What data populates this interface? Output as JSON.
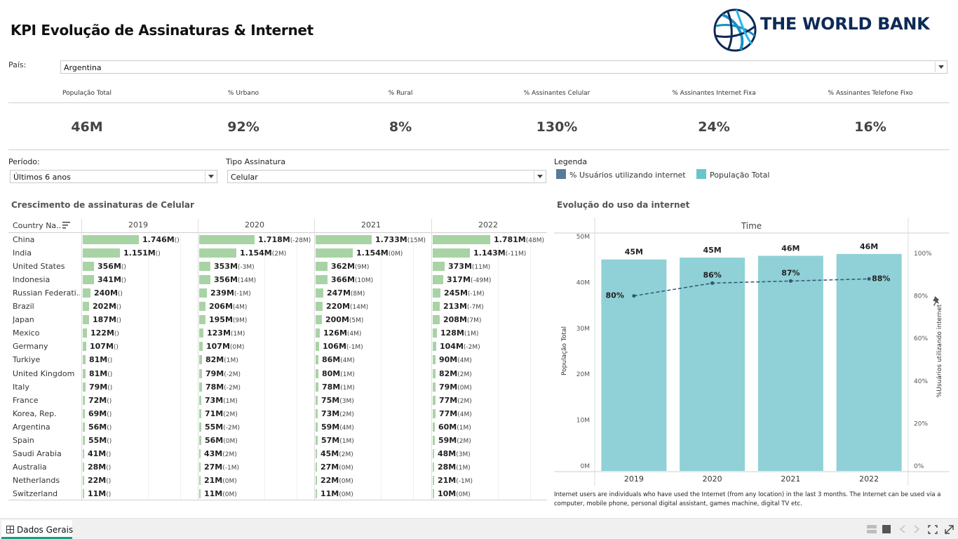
{
  "title": "KPI Evolução de Assinaturas & Internet",
  "logo": {
    "text": "THE WORLD BANK",
    "color": "#0d2a56"
  },
  "country_filter": {
    "label": "País:",
    "value": "Argentina"
  },
  "kpis": [
    {
      "label": "População Total",
      "value": "46M"
    },
    {
      "label": "% Urbano",
      "value": "92%"
    },
    {
      "label": "% Rural",
      "value": "8%"
    },
    {
      "label": "% Assinantes Celular",
      "value": "130%"
    },
    {
      "label": "% Assinantes Internet Fixa",
      "value": "24%"
    },
    {
      "label": "% Assinantes Telefone Fixo",
      "value": "16%"
    }
  ],
  "period_filter": {
    "label": "Período:",
    "value": "Últimos 6 anos"
  },
  "type_filter": {
    "label": "Tipo Assinatura",
    "value": "Celular"
  },
  "legend": {
    "title": "Legenda",
    "items": [
      {
        "label": "% Usuários utilizando internet",
        "color": "#5b7a99"
      },
      {
        "label": "População Total",
        "color": "#69c5c9"
      }
    ]
  },
  "table": {
    "title": "Crescimento de assinaturas de Celular",
    "column_header": "Country Na..",
    "years": [
      "2019",
      "2020",
      "2021",
      "2022"
    ],
    "rows": [
      {
        "country": "China",
        "cells": [
          [
            "1.746M",
            "()"
          ],
          [
            "1.718M",
            "(-28M)"
          ],
          [
            "1.733M",
            "(15M)"
          ],
          [
            "1.781M",
            "(48M)"
          ]
        ]
      },
      {
        "country": "India",
        "cells": [
          [
            "1.151M",
            "()"
          ],
          [
            "1.154M",
            "(2M)"
          ],
          [
            "1.154M",
            "(0M)"
          ],
          [
            "1.143M",
            "(-11M)"
          ]
        ]
      },
      {
        "country": "United States",
        "cells": [
          [
            "356M",
            "()"
          ],
          [
            "353M",
            "(-3M)"
          ],
          [
            "362M",
            "(9M)"
          ],
          [
            "373M",
            "(11M)"
          ]
        ]
      },
      {
        "country": "Indonesia",
        "cells": [
          [
            "341M",
            "()"
          ],
          [
            "356M",
            "(14M)"
          ],
          [
            "366M",
            "(10M)"
          ],
          [
            "317M",
            "(-49M)"
          ]
        ]
      },
      {
        "country": "Russian Federati..",
        "cells": [
          [
            "240M",
            "()"
          ],
          [
            "239M",
            "(-1M)"
          ],
          [
            "247M",
            "(8M)"
          ],
          [
            "245M",
            "(-1M)"
          ]
        ]
      },
      {
        "country": "Brazil",
        "cells": [
          [
            "202M",
            "()"
          ],
          [
            "206M",
            "(4M)"
          ],
          [
            "220M",
            "(14M)"
          ],
          [
            "213M",
            "(-7M)"
          ]
        ]
      },
      {
        "country": "Japan",
        "cells": [
          [
            "187M",
            "()"
          ],
          [
            "195M",
            "(9M)"
          ],
          [
            "200M",
            "(5M)"
          ],
          [
            "208M",
            "(7M)"
          ]
        ]
      },
      {
        "country": "Mexico",
        "cells": [
          [
            "122M",
            "()"
          ],
          [
            "123M",
            "(1M)"
          ],
          [
            "126M",
            "(4M)"
          ],
          [
            "128M",
            "(1M)"
          ]
        ]
      },
      {
        "country": "Germany",
        "cells": [
          [
            "107M",
            "()"
          ],
          [
            "107M",
            "(0M)"
          ],
          [
            "106M",
            "(-1M)"
          ],
          [
            "104M",
            "(-2M)"
          ]
        ]
      },
      {
        "country": "Turkiye",
        "cells": [
          [
            "81M",
            "()"
          ],
          [
            "82M",
            "(1M)"
          ],
          [
            "86M",
            "(4M)"
          ],
          [
            "90M",
            "(4M)"
          ]
        ]
      },
      {
        "country": "United Kingdom",
        "cells": [
          [
            "81M",
            "()"
          ],
          [
            "79M",
            "(-2M)"
          ],
          [
            "80M",
            "(1M)"
          ],
          [
            "82M",
            "(2M)"
          ]
        ]
      },
      {
        "country": "Italy",
        "cells": [
          [
            "79M",
            "()"
          ],
          [
            "78M",
            "(-2M)"
          ],
          [
            "78M",
            "(1M)"
          ],
          [
            "79M",
            "(0M)"
          ]
        ]
      },
      {
        "country": "France",
        "cells": [
          [
            "72M",
            "()"
          ],
          [
            "73M",
            "(1M)"
          ],
          [
            "75M",
            "(3M)"
          ],
          [
            "77M",
            "(2M)"
          ]
        ]
      },
      {
        "country": "Korea, Rep.",
        "cells": [
          [
            "69M",
            "()"
          ],
          [
            "71M",
            "(2M)"
          ],
          [
            "73M",
            "(2M)"
          ],
          [
            "77M",
            "(4M)"
          ]
        ]
      },
      {
        "country": "Argentina",
        "cells": [
          [
            "56M",
            "()"
          ],
          [
            "55M",
            "(-2M)"
          ],
          [
            "59M",
            "(4M)"
          ],
          [
            "60M",
            "(1M)"
          ]
        ]
      },
      {
        "country": "Spain",
        "cells": [
          [
            "55M",
            "()"
          ],
          [
            "56M",
            "(0M)"
          ],
          [
            "57M",
            "(1M)"
          ],
          [
            "59M",
            "(2M)"
          ]
        ]
      },
      {
        "country": "Saudi Arabia",
        "cells": [
          [
            "41M",
            "()"
          ],
          [
            "43M",
            "(2M)"
          ],
          [
            "45M",
            "(2M)"
          ],
          [
            "48M",
            "(3M)"
          ]
        ]
      },
      {
        "country": "Australia",
        "cells": [
          [
            "28M",
            "()"
          ],
          [
            "27M",
            "(-1M)"
          ],
          [
            "27M",
            "(0M)"
          ],
          [
            "28M",
            "(1M)"
          ]
        ]
      },
      {
        "country": "Netherlands",
        "cells": [
          [
            "22M",
            "()"
          ],
          [
            "21M",
            "(0M)"
          ],
          [
            "22M",
            "(0M)"
          ],
          [
            "21M",
            "(-1M)"
          ]
        ]
      },
      {
        "country": "Switzerland",
        "cells": [
          [
            "11M",
            "()"
          ],
          [
            "11M",
            "(0M)"
          ],
          [
            "11M",
            "(0M)"
          ],
          [
            "10M",
            "(0M)"
          ]
        ]
      }
    ]
  },
  "chart_data": {
    "type": "bar",
    "title": "Evolução do uso da internet",
    "x_header": "Time",
    "categories": [
      "2019",
      "2020",
      "2021",
      "2022"
    ],
    "series": [
      {
        "name": "População Total",
        "values": [
          45,
          45.4,
          45.8,
          46.2
        ],
        "value_labels": [
          "45M",
          "45M",
          "46M",
          "46M"
        ],
        "color": "#8fd1d6",
        "axis": "left"
      },
      {
        "name": "% Usuários utilizando internet",
        "values": [
          80,
          86,
          87,
          88
        ],
        "value_labels": [
          "80%",
          "86%",
          "87%",
          "88%"
        ],
        "color": "#2f5578",
        "axis": "right",
        "style": "dashed-line"
      }
    ],
    "ylabel": "População Total",
    "ylim": [
      0,
      50
    ],
    "yticks": [
      "0M",
      "10M",
      "20M",
      "30M",
      "40M",
      "50M"
    ],
    "y2label": "%Usuários utilizando internet",
    "y2lim": [
      0,
      100
    ],
    "y2ticks": [
      "0%",
      "20%",
      "40%",
      "60%",
      "80%",
      "100%"
    ]
  },
  "note": "Internet users are individuals who have used the Internet (from any location) in the last 3 months. The Internet can be used via a computer, mobile phone, personal digital assistant, games machine, digital TV etc.",
  "tabs": [
    {
      "label": "Dados Gerais"
    }
  ],
  "icons": [
    "globe-icon",
    "dropdown-arrow-icon",
    "sort-icon",
    "pin-icon",
    "sheet-tab-icon",
    "layout-icon",
    "stop-icon",
    "back-icon",
    "forward-icon",
    "fullscreen-icon",
    "expand-icon"
  ]
}
